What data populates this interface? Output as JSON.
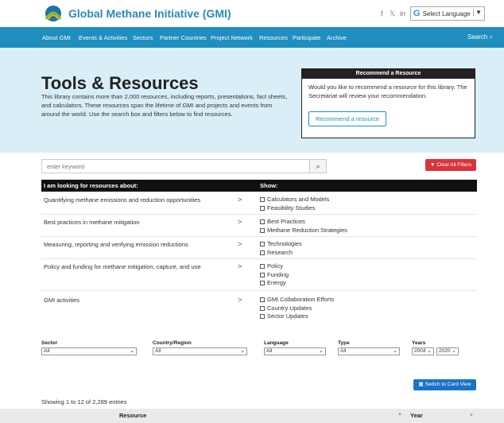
{
  "header": {
    "logo_text": "Global Methane Initiative (GMI)",
    "social": [
      "f",
      "𝕏",
      "in"
    ],
    "language_label": "Select Language"
  },
  "nav": {
    "items": [
      "About GMI",
      "Events & Activities",
      "Sectors",
      "Partner Countries",
      "Project Network",
      "Resources",
      "Participate",
      "Archive"
    ],
    "search_label": "Search"
  },
  "hero": {
    "title": "Tools & Resources",
    "description": "This library contains more than 2,000 resources, including reports, presentations, fact sheets, and calculators. These resources span the lifetime of GMI and projects and events from around the world. Use the search box and filters below to find resources."
  },
  "recommend": {
    "heading": "Recommend a Resource",
    "text": "Would you like to recommend a resource for this library. The Secretariat will review your recommendation.",
    "button": "Recommend a resource"
  },
  "search": {
    "placeholder": "enter keyword",
    "clear_label": "Clear All Filters"
  },
  "filters": {
    "left_heading": "I am looking for resources about:",
    "right_heading": "Show:",
    "rows": [
      {
        "topic": "Quantifying methane emissions and reduction opportunities",
        "options": [
          "Calculators and Models",
          "Feasibility Studies"
        ]
      },
      {
        "topic": "Best practices in methane mitigation",
        "options": [
          "Best Practices",
          "Methane Reduction Strategies"
        ]
      },
      {
        "topic": "Measuring, reporting and verifying emission reductions",
        "options": [
          "Technologies",
          "Research"
        ]
      },
      {
        "topic": "Policy and funding for methane mitigation, capture, and use",
        "options": [
          "Policy",
          "Funding",
          "Energy"
        ]
      },
      {
        "topic": "GMI activities",
        "options": [
          "GMI Collaboration Efforts",
          "Country Updates",
          "Sector Updates"
        ]
      }
    ]
  },
  "selects": {
    "sector": {
      "label": "Sector",
      "value": "All"
    },
    "country": {
      "label": "Country/Region",
      "value": "All"
    },
    "language": {
      "label": "Language",
      "value": "All"
    },
    "type": {
      "label": "Type",
      "value": "All"
    },
    "years": {
      "label": "Years",
      "from": "2004",
      "to": "2020"
    }
  },
  "results": {
    "card_view_label": "Switch to Card View",
    "showing_text": "Showing 1 to 12 of 2,289 entries",
    "col_resource": "Resource",
    "col_year": "Year"
  },
  "colors": {
    "nav": "#1f8fbf",
    "hero": "#d9eef7",
    "clear": "#d9343a",
    "card": "#1a73c8"
  }
}
